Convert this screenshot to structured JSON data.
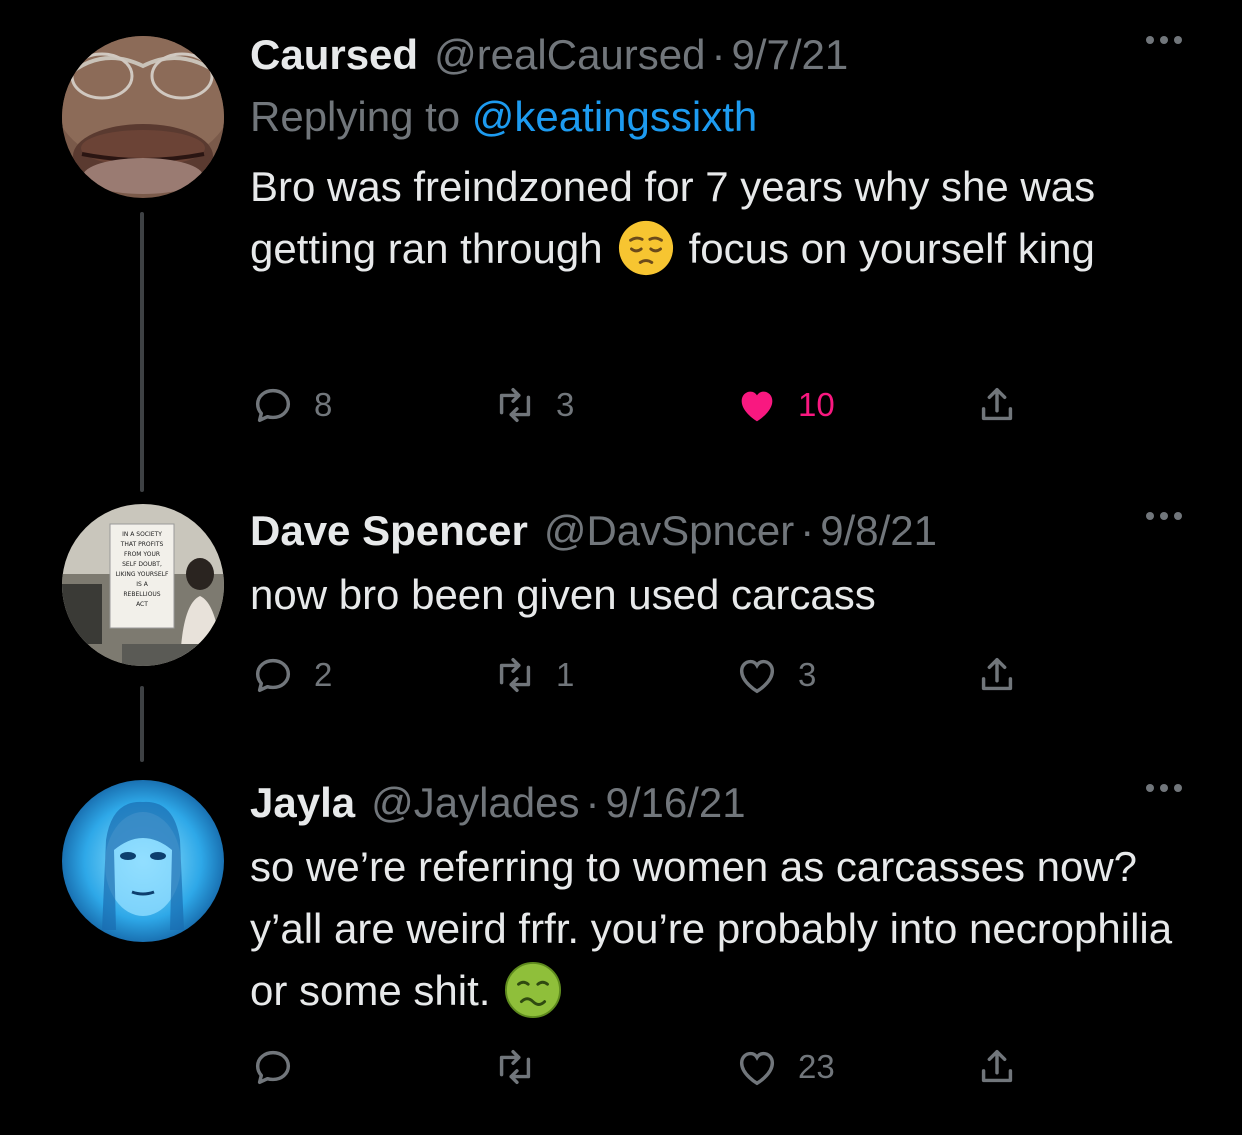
{
  "tweets": [
    {
      "name": "Caursed",
      "handle": "@realCaursed",
      "date": "9/7/21",
      "replying_prefix": "Replying to",
      "replying_to": "@keatingssixth",
      "text_part1": "Bro was freindzoned for 7 years why she was getting ran through",
      "emoji": "pensive-face-emoji",
      "text_part2": "focus on yourself king",
      "replies": "8",
      "retweets": "3",
      "likes": "10",
      "liked": true
    },
    {
      "name": "Dave Spencer",
      "handle": "@DavSpncer",
      "date": "9/8/21",
      "text": "now bro been given used carcass",
      "replies": "2",
      "retweets": "1",
      "likes": "3",
      "liked": false,
      "avatar_text": [
        "IN A SOCIETY",
        "THAT PROFITS",
        "FROM YOUR",
        "SELF DOUBT,",
        "LIKING YOURSELF",
        "IS A",
        "REBELLIOUS",
        "ACT"
      ]
    },
    {
      "name": "Jayla",
      "handle": "@Jaylades",
      "date": "9/16/21",
      "text_part1": "so we’re referring to women as carcasses now? y’all are weird frfr. you’re probably into necrophilia or some shit.",
      "emoji": "nauseated-face-emoji",
      "replies": "",
      "retweets": "",
      "likes": "23",
      "liked": false
    }
  ],
  "colors": {
    "background": "#000000",
    "text": "#e7e9ea",
    "secondary": "#71767b",
    "link": "#1d9bf0",
    "like": "#f91880"
  }
}
